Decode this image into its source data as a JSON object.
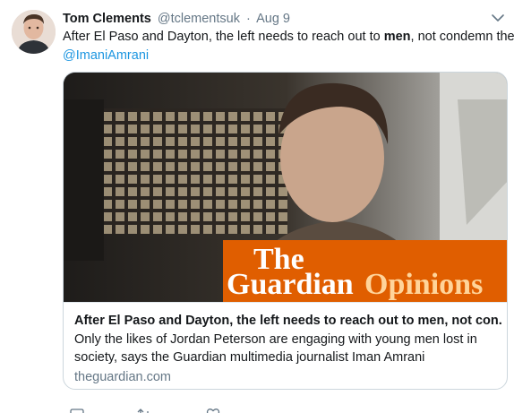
{
  "tweet": {
    "author_name": "Tom Clements",
    "author_handle": "@tclementsuk",
    "separator": "·",
    "date": "Aug 9",
    "text_before_bold": "After El Paso and Dayton, the left needs to reach out to ",
    "text_bold": "men",
    "text_after_bold": ", not condemn them |",
    "mention": "@ImaniAmrani"
  },
  "card": {
    "image_brand_line1": "The",
    "image_brand_line2": "Guardian",
    "image_brand_section": "Opinions",
    "title": "After El Paso and Dayton, the left needs to reach out to men, not con...",
    "description_line1": "Only the likes of Jordan Peterson are engaging with young men lost in",
    "description_line2": "society, says the Guardian multimedia journalist Iman Amrani",
    "domain": "theguardian.com"
  },
  "icons": {
    "avatar": "avatar-photo",
    "caret": "chevron-down-icon",
    "actions": [
      "reply-icon",
      "retweet-icon",
      "like-icon"
    ]
  },
  "colors": {
    "link": "#1b95e0",
    "secondary_text": "#657786",
    "guardian_orange": "#e05e00",
    "card_border": "#ccd6dd"
  }
}
